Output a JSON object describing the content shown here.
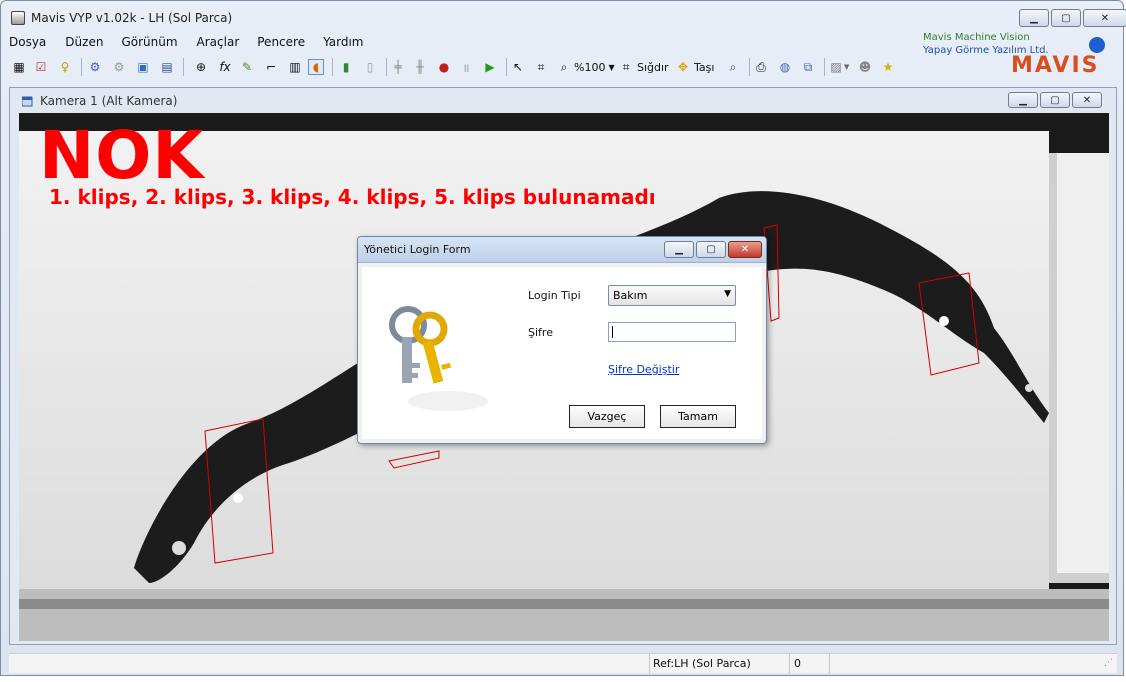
{
  "window": {
    "title": "Mavis VYP v1.02k - LH (Sol Parca)"
  },
  "menu": [
    "Dosya",
    "Düzen",
    "Görünüm",
    "Araçlar",
    "Pencere",
    "Yardım"
  ],
  "brand": {
    "line1": "Mavis Machine Vision",
    "line2": "Yapay Görme Yazılım Ltd.",
    "logo": "MAVIS"
  },
  "toolbar": {
    "zoom_label": "%100",
    "fit_label": "Sığdır",
    "move_label": "Taşı"
  },
  "child": {
    "title": "Kamera 1 (Alt Kamera)"
  },
  "inspection": {
    "result": "NOK",
    "message": "1. klips, 2. klips, 3. klips, 4. klips, 5. klips bulunamadı"
  },
  "dialog": {
    "title": "Yönetici Login Form",
    "login_type_label": "Login Tipi",
    "login_type_value": "Bakım",
    "password_label": "Şifre",
    "change_password_link": "Şifre Değiştir",
    "cancel_label": "Vazgeç",
    "ok_label": "Tamam"
  },
  "status": {
    "ref": "Ref:LH (Sol Parca)",
    "count": "0"
  },
  "colors": {
    "nok_red": "#ff0000",
    "roi_red": "#d40000"
  }
}
